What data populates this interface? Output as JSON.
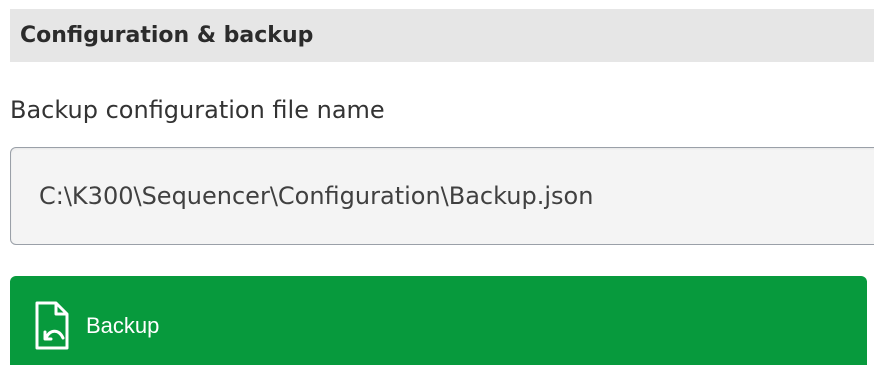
{
  "section": {
    "title": "Configuration & backup"
  },
  "backup_file": {
    "label": "Backup configuration file name",
    "value": "C:\\K300\\Sequencer\\Configuration\\Backup.json"
  },
  "backup_button": {
    "label": "Backup",
    "icon": "file-backup-icon"
  },
  "colors": {
    "header_background": "#e6e6e6",
    "button_green": "#079a3d",
    "input_background": "#f4f4f4"
  }
}
